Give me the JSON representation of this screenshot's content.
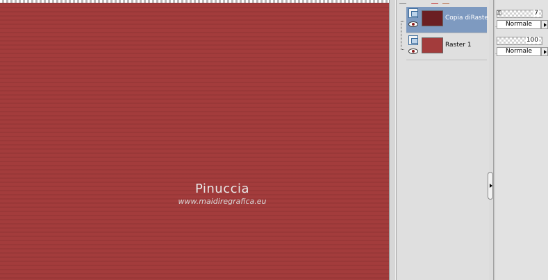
{
  "canvas": {
    "watermark_title": "Pinuccia",
    "watermark_url": "www.maidiregrafica.eu",
    "color": "#a33c3c"
  },
  "layers": [
    {
      "name": "Copia diRaster",
      "selected": true,
      "thumb_color": "#6b1f22",
      "opacity": "7",
      "blend": "Normale",
      "type_icon": "raster-layer-icon",
      "visibility_icon": "eye-icon"
    },
    {
      "name": "Raster 1",
      "selected": false,
      "thumb_color": "#a33c3c",
      "opacity": "100",
      "blend": "Normale",
      "type_icon": "raster-layer-icon",
      "visibility_icon": "eye-icon"
    }
  ],
  "colors": {
    "selection": "#7e9ac0",
    "panel": "#dfdfdf"
  }
}
